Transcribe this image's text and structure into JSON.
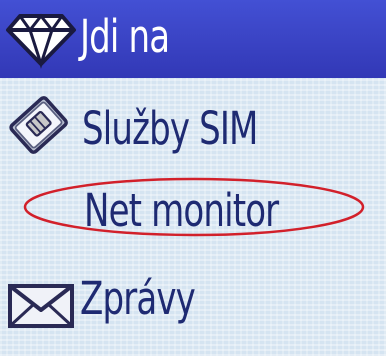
{
  "menu": {
    "items": [
      {
        "label": "Jdi na",
        "icon": "diamond-icon",
        "selected": true
      },
      {
        "label": "Služby SIM",
        "icon": "sim-card-icon",
        "selected": false
      },
      {
        "label": "Net monitor",
        "icon": "",
        "selected": false,
        "annotated": true
      },
      {
        "label": "Zprávy",
        "icon": "envelope-icon",
        "selected": false
      }
    ]
  },
  "colors": {
    "highlight": "#3b44c8",
    "menu_text": "#1e2a72",
    "background": "#d5e4f1",
    "annotation_ellipse": "#d2202a"
  }
}
